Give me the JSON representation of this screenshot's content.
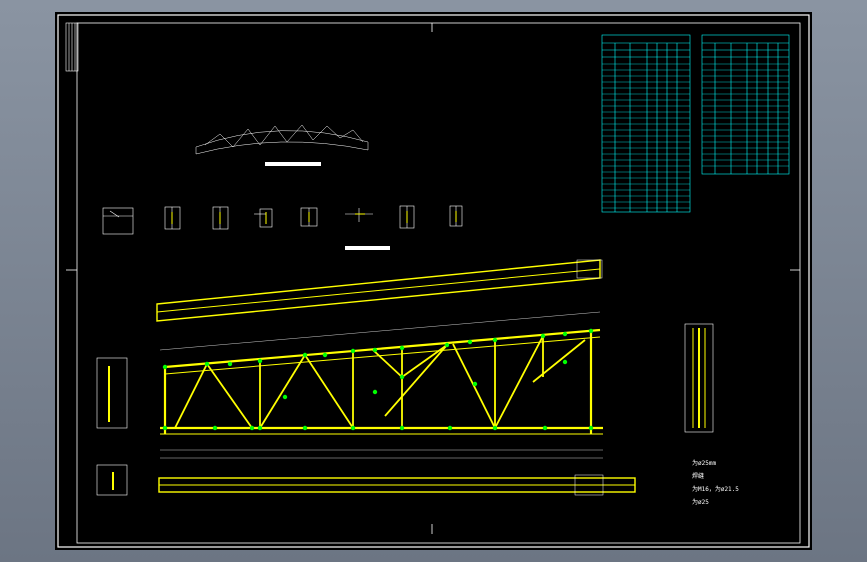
{
  "notes": {
    "visible_lines": [
      "为ø25mm",
      "焊缝",
      "为M16，为ø21.5",
      "为ø25"
    ]
  },
  "colors": {
    "background": "#000000",
    "frame": "#ffffff",
    "truss_chord": "#ffff00",
    "truss_web": "#ffff00",
    "bolt": "#00ff00",
    "table_lines": "#00ffff",
    "dims": "#ffffff"
  },
  "tables": {
    "count": 2,
    "columns": 7,
    "rows": 25
  }
}
